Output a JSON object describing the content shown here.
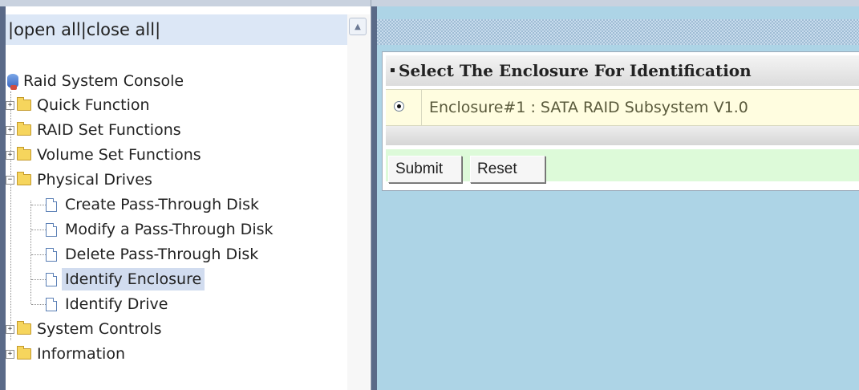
{
  "left_panel": {
    "open_close": {
      "sep1": "|",
      "open_all": "open all",
      "sep2": "|",
      "close_all": "close all",
      "sep3": "|"
    },
    "root_label": "Raid System Console",
    "tree": [
      {
        "label": "Quick Function",
        "expanded": false,
        "toggle": "+"
      },
      {
        "label": "RAID Set Functions",
        "expanded": false,
        "toggle": "+"
      },
      {
        "label": "Volume Set Functions",
        "expanded": false,
        "toggle": "+"
      },
      {
        "label": "Physical Drives",
        "expanded": true,
        "toggle": "−",
        "children": [
          "Create Pass-Through Disk",
          "Modify a Pass-Through Disk",
          "Delete Pass-Through Disk",
          "Identify Enclosure",
          "Identify Drive"
        ],
        "selected_child": "Identify Enclosure"
      },
      {
        "label": "System Controls",
        "expanded": false,
        "toggle": "+"
      },
      {
        "label": "Information",
        "expanded": false,
        "toggle": "+"
      }
    ]
  },
  "main": {
    "panel_title": "Select The Enclosure For Identification",
    "enclosure_option": "Enclosure#1 : SATA RAID Subsystem V1.0",
    "buttons": {
      "submit": "Submit",
      "reset": "Reset"
    }
  },
  "colors": {
    "content_background": "#add4e6",
    "button_row_background": "#ddfad9",
    "option_row_background": "#fffde0",
    "tree_selection": "#d1dcef"
  }
}
